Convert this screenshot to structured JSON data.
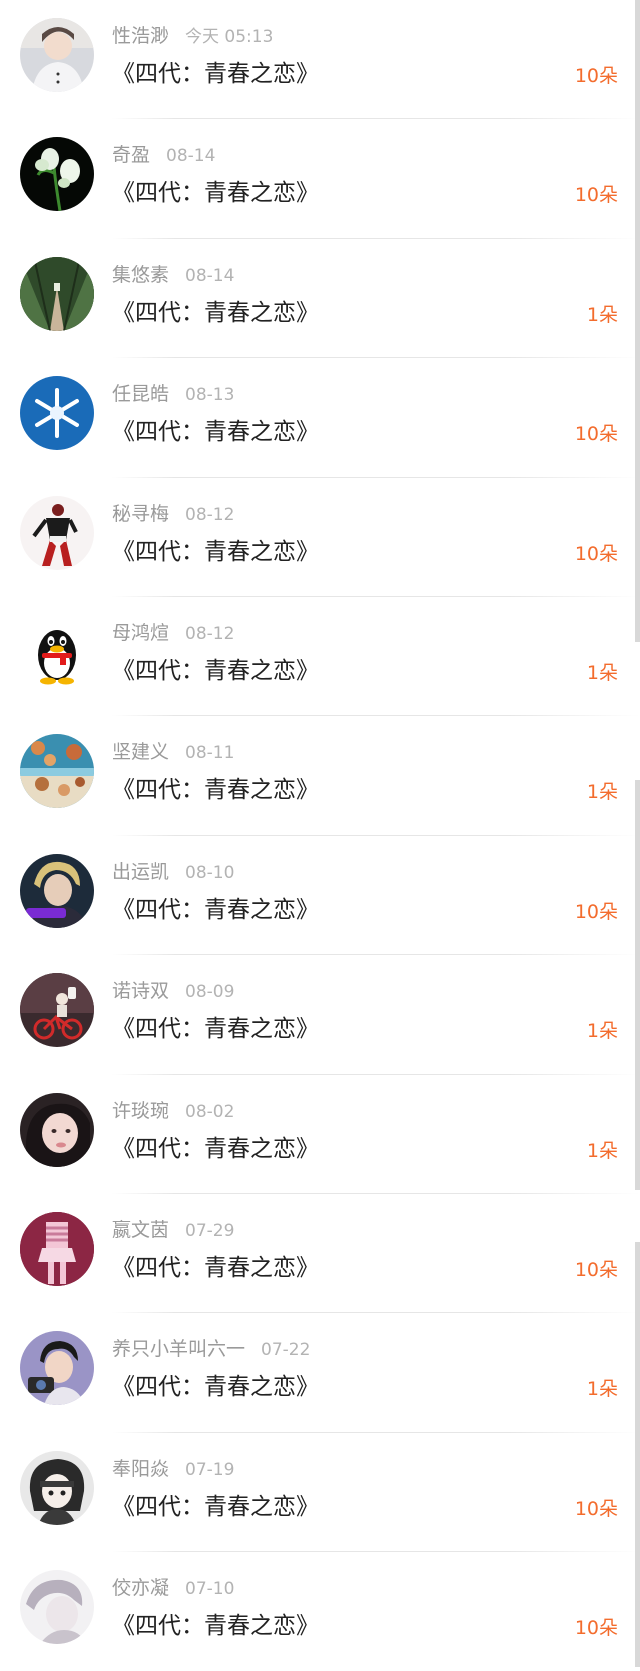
{
  "records": [
    {
      "name": "性浩渺",
      "time": "今天 05:13",
      "title": "《四代：青春之恋》",
      "amount": "10朵",
      "avatar": "portrait-white-shirt"
    },
    {
      "name": "奇盈",
      "time": "08-14",
      "title": "《四代：青春之恋》",
      "amount": "10朵",
      "avatar": "white-flower"
    },
    {
      "name": "集悠素",
      "time": "08-14",
      "title": "《四代：青春之恋》",
      "amount": "1朵",
      "avatar": "tree-lined-road"
    },
    {
      "name": "任昆皓",
      "time": "08-13",
      "title": "《四代：青春之恋》",
      "amount": "10朵",
      "avatar": "snowflake"
    },
    {
      "name": "秘寻梅",
      "time": "08-12",
      "title": "《四代：青春之恋》",
      "amount": "10朵",
      "avatar": "anime-character"
    },
    {
      "name": "母鸿煊",
      "time": "08-12",
      "title": "《四代：青春之恋》",
      "amount": "1朵",
      "avatar": "qq-penguin"
    },
    {
      "name": "坚建义",
      "time": "08-11",
      "title": "《四代：青春之恋》",
      "amount": "1朵",
      "avatar": "seashells"
    },
    {
      "name": "出运凯",
      "time": "08-10",
      "title": "《四代：青春之恋》",
      "amount": "10朵",
      "avatar": "blonde-portrait"
    },
    {
      "name": "诺诗双",
      "time": "08-09",
      "title": "《四代：青春之恋》",
      "amount": "1朵",
      "avatar": "bicycle-figure"
    },
    {
      "name": "许琰琬",
      "time": "08-02",
      "title": "《四代：青春之恋》",
      "amount": "1朵",
      "avatar": "girl-portrait"
    },
    {
      "name": "嬴文茵",
      "time": "07-29",
      "title": "《四代：青春之恋》",
      "amount": "10朵",
      "avatar": "pink-figure"
    },
    {
      "name": "养只小羊叫六一",
      "time": "07-22",
      "title": "《四代：青春之恋》",
      "amount": "1朵",
      "avatar": "boy-camera"
    },
    {
      "name": "奉阳焱",
      "time": "07-19",
      "title": "《四代：青春之恋》",
      "amount": "10朵",
      "avatar": "sketch-portrait"
    },
    {
      "name": "佼亦凝",
      "time": "07-10",
      "title": "《四代：青春之恋》",
      "amount": "10朵",
      "avatar": "faded-portrait"
    }
  ],
  "colors": {
    "accent": "#f36c2d",
    "name_text": "#9a9a9a",
    "time_text": "#b3b3b3",
    "title_text": "#222222"
  }
}
